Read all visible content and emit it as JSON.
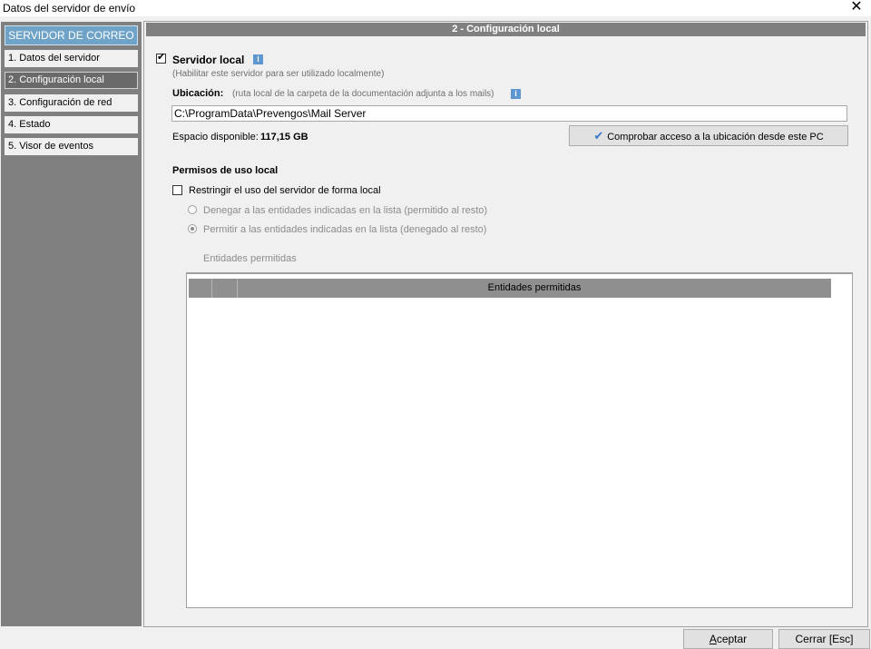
{
  "window": {
    "title": "Datos del servidor de envío",
    "close_glyph": "✕"
  },
  "sidebar": {
    "header": "SERVIDOR DE CORREO",
    "items": [
      {
        "label": "1. Datos del servidor"
      },
      {
        "label": "2. Configuración local"
      },
      {
        "label": "3. Configuración de red"
      },
      {
        "label": "4. Estado"
      },
      {
        "label": "5. Visor de eventos"
      }
    ],
    "active_index": 1
  },
  "panel": {
    "header": "2 - Configuración local",
    "local_server": {
      "label": "Servidor local",
      "checked": true,
      "hint": "(Habilitar este servidor para ser utilizado localmente)",
      "info_icon": "info-icon"
    },
    "location": {
      "label": "Ubicación:",
      "hint": "(ruta local de la carpeta de la documentación adjunta a los mails)",
      "value": "C:\\ProgramData\\Prevengos\\Mail Server"
    },
    "space": {
      "label": "Espacio disponible:",
      "value": "117,15 GB"
    },
    "check_button": {
      "label": "Comprobar acceso a la ubicación desde este PC",
      "icon": "checkmark-icon"
    },
    "permissions": {
      "title": "Permisos de uso local",
      "restrict_label": "Restringir el uso del servidor de forma local",
      "restrict_checked": false,
      "deny_option": "Denegar a las entidades indicadas en la lista (permitido al resto)",
      "allow_option": "Permitir a las entidades indicadas en la lista (denegado al resto)",
      "selected_option": "allow",
      "list_label": "Entidades permitidas",
      "grid_column": "Entidades permitidas"
    }
  },
  "footer": {
    "ok_label_accel": "A",
    "ok_label_rest": "ceptar",
    "cancel_label": "Cerrar  [Esc]"
  }
}
